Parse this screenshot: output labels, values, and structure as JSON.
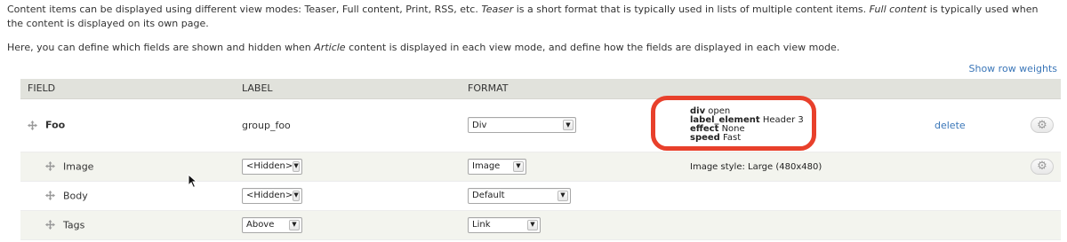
{
  "description": {
    "p1_before_teaser": "Content items can be displayed using different view modes: Teaser, Full content, Print, RSS, etc. ",
    "p1_teaser": "Teaser",
    "p1_middle": " is a short format that is typically used in lists of multiple content items. ",
    "p1_full": "Full content",
    "p1_after": " is typically used when the content is displayed on its own page.",
    "p2_before": "Here, you can define which fields are shown and hidden when ",
    "p2_article": "Article",
    "p2_after": " content is displayed in each view mode, and define how the fields are displayed in each view mode."
  },
  "show_row_weights": "Show row weights",
  "table": {
    "headers": {
      "field": "FIELD",
      "label": "LABEL",
      "format": "FORMAT"
    },
    "rows": [
      {
        "name": "Foo",
        "label_text": "group_foo",
        "format": "Div",
        "summary": [
          {
            "key": "div",
            "value": "open"
          },
          {
            "key": "label_element",
            "value": "Header 3"
          },
          {
            "key": "effect",
            "value": "None"
          },
          {
            "key": "speed",
            "value": "Fast"
          }
        ],
        "delete": "delete"
      },
      {
        "name": "Image",
        "label": "<Hidden>",
        "format": "Image",
        "summary": "Image style: Large (480x480)"
      },
      {
        "name": "Body",
        "label": "<Hidden>",
        "format": "Default"
      },
      {
        "name": "Tags",
        "label": "Above",
        "format": "Link"
      }
    ]
  },
  "colors": {
    "header_bg": "#e1e2dc",
    "row_alt_bg": "#f3f4ee",
    "link": "#3a76b8",
    "highlight": "#e8402b"
  },
  "icons": {
    "drag_handle": "drag-handle-icon",
    "settings": "gear-icon",
    "select_arrow": "chevron-down-icon",
    "pointer": "mouse-pointer-icon"
  }
}
